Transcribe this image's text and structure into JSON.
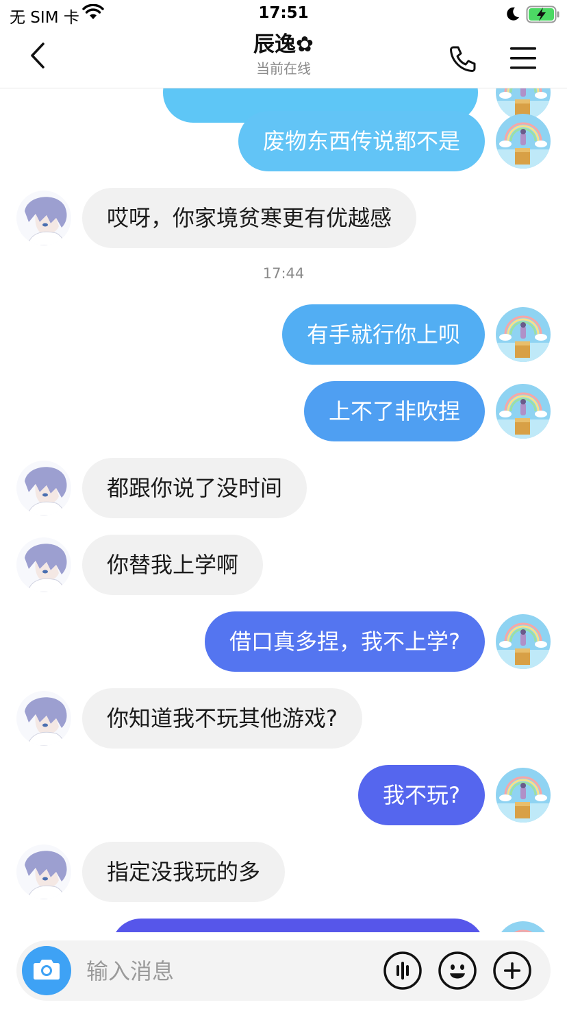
{
  "status": {
    "carrier": "无 SIM 卡",
    "time": "17:51"
  },
  "header": {
    "title": "辰逸✿",
    "subtitle": "当前在线",
    "back_icon": "chevron-left-icon",
    "call_icon": "phone-icon",
    "menu_icon": "hamburger-menu-icon"
  },
  "chat": {
    "timestamp": "17:44",
    "messages": [
      {
        "side": "out",
        "text": "废物东西传说都不是",
        "color": "#62c4f6"
      },
      {
        "side": "in",
        "text": "哎呀，你家境贫寒更有优越感"
      },
      {
        "side": "out",
        "text": "有手就行你上呗",
        "color": "#52aef3"
      },
      {
        "side": "out",
        "text": "上不了非吹捏",
        "color": "#4f9ff2"
      },
      {
        "side": "in",
        "text": "都跟你说了没时间"
      },
      {
        "side": "in",
        "text": "你替我上学啊"
      },
      {
        "side": "out",
        "text": "借口真多捏，我不上学?",
        "color": "#5475f0"
      },
      {
        "side": "in",
        "text": "你知道我不玩其他游戏?"
      },
      {
        "side": "out",
        "text": "我不玩?",
        "color": "#5566ee"
      },
      {
        "side": "in",
        "text": "指定没我玩的多"
      },
      {
        "side": "out",
        "text": "",
        "color": "#5656ea"
      }
    ]
  },
  "input": {
    "placeholder": "输入消息",
    "camera_icon": "camera-icon",
    "voice_icon": "voice-wave-icon",
    "emoji_icon": "emoji-icon",
    "add_icon": "plus-circle-icon"
  },
  "colors": {
    "incoming_bubble": "#f1f1f1",
    "camera_button": "#3ea2f5"
  }
}
